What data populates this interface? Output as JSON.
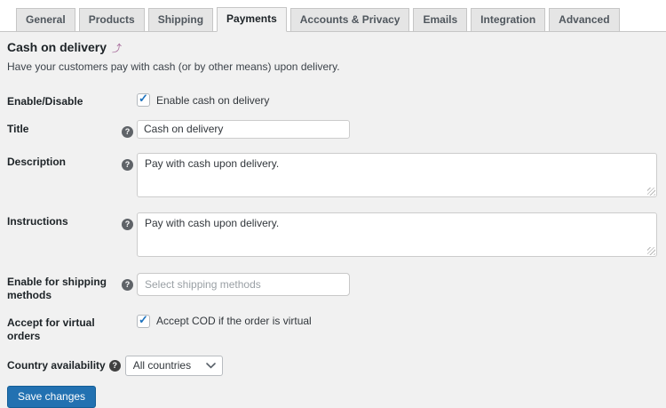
{
  "tabs": {
    "items": [
      {
        "label": "General",
        "active": false
      },
      {
        "label": "Products",
        "active": false
      },
      {
        "label": "Shipping",
        "active": false
      },
      {
        "label": "Payments",
        "active": true
      },
      {
        "label": "Accounts & Privacy",
        "active": false
      },
      {
        "label": "Emails",
        "active": false
      },
      {
        "label": "Integration",
        "active": false
      },
      {
        "label": "Advanced",
        "active": false
      }
    ]
  },
  "page": {
    "heading": "Cash on delivery",
    "intro": "Have your customers pay with cash (or by other means) upon delivery."
  },
  "icons": {
    "back_arrow": "⤴",
    "help": "?",
    "check": "✓"
  },
  "form": {
    "enable": {
      "label": "Enable/Disable",
      "checkbox_label": "Enable cash on delivery",
      "checked": true
    },
    "title": {
      "label": "Title",
      "value": "Cash on delivery"
    },
    "description": {
      "label": "Description",
      "value": "Pay with cash upon delivery."
    },
    "instructions": {
      "label": "Instructions",
      "value": "Pay with cash upon delivery."
    },
    "shipping_methods": {
      "label": "Enable for shipping methods",
      "placeholder": "Select shipping methods"
    },
    "virtual_orders": {
      "label": "Accept for virtual orders",
      "checkbox_label": "Accept COD if the order is virtual",
      "checked": true
    },
    "country_availability": {
      "label": "Country availability",
      "value": "All countries"
    },
    "save_label": "Save changes"
  },
  "colors": {
    "accent": "#2271b1",
    "content_bg": "#f1f1f1",
    "tab_bg": "#e5e5e5",
    "check_blue": "#1e73be",
    "back_arrow_purple": "#a36597"
  }
}
